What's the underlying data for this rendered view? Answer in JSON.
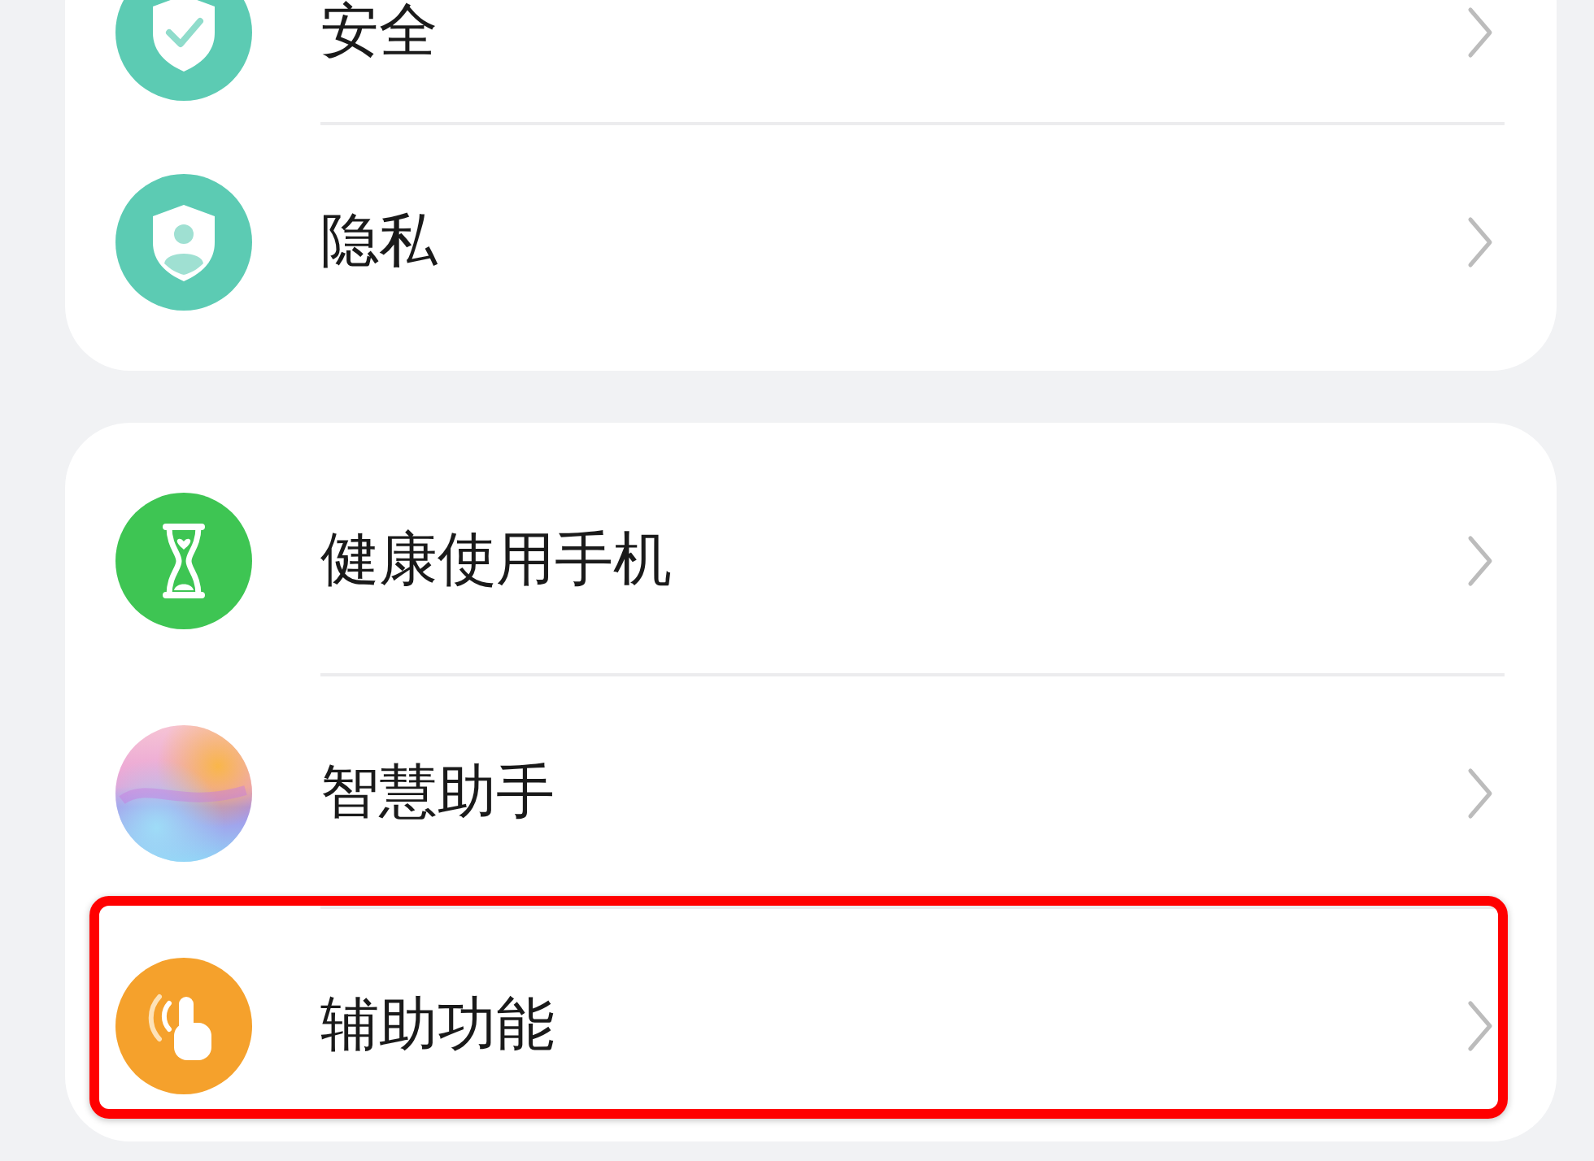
{
  "groups": [
    {
      "items": [
        {
          "label": "安全",
          "highlighted": false
        },
        {
          "label": "隐私",
          "highlighted": false
        }
      ]
    },
    {
      "items": [
        {
          "label": "健康使用手机",
          "highlighted": false
        },
        {
          "label": "智慧助手",
          "highlighted": false
        },
        {
          "label": "辅助功能",
          "highlighted": true
        }
      ]
    }
  ]
}
